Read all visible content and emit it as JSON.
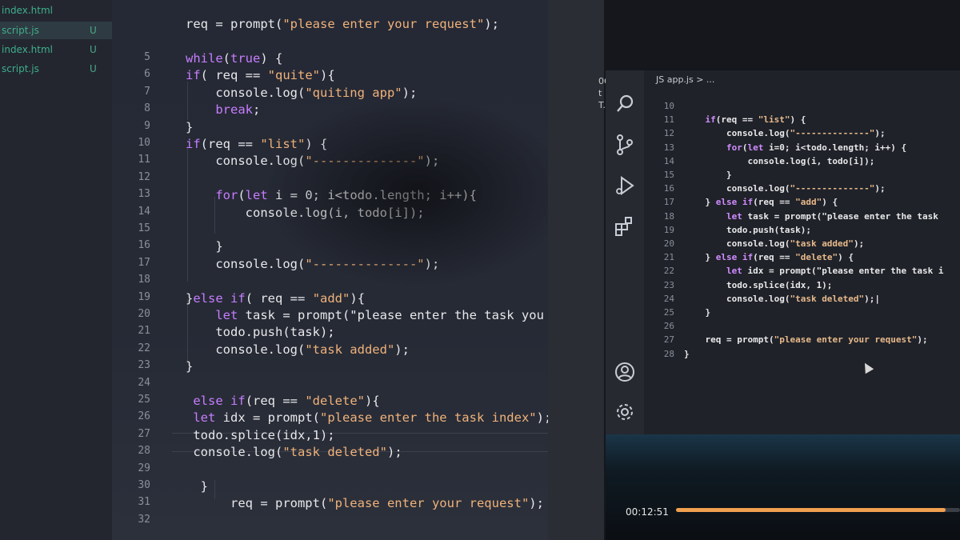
{
  "left": {
    "explorer": [
      {
        "name": "index.html",
        "status": ""
      },
      {
        "name": "script.js",
        "status": "U"
      },
      {
        "name": "index.html",
        "status": "U"
      },
      {
        "name": "script.js",
        "status": "U"
      }
    ],
    "line_numbers": [
      "5",
      "6",
      "7",
      "8",
      "9",
      "10",
      "11",
      "12",
      "13",
      "14",
      "15",
      "16",
      "17",
      "18",
      "19",
      "20",
      "21",
      "22",
      "23",
      "24",
      "25",
      "26",
      "27",
      "28",
      "29",
      "30",
      "31",
      "32"
    ],
    "top_line": "req = prompt(\"please enter your request\");",
    "code": [
      "while(true) {",
      "if( req == \"quite\"){",
      "    console.log(\"quiting app\");",
      "    break;",
      "}",
      "if(req == \"list\") {",
      "    console.log(\"--------------\");",
      "",
      "    for(let i = 0; i<todo.length; i++){",
      "        console.log(i, todo[i]);",
      "",
      "    }",
      "    console.log(\"--------------\");",
      "",
      "}else if( req == \"add\"){",
      "    let task = prompt(\"please enter the task you want",
      "    todo.push(task);",
      "    console.log(\"task added\");",
      "}",
      "",
      " else if(req == \"delete\"){",
      " let idx = prompt(\"please enter the task index\");",
      " todo.splice(idx,1);",
      " console.log(\"task deleted\");",
      "",
      "  }",
      "      req = prompt(\"please enter your request\");",
      ""
    ]
  },
  "right": {
    "side_text": [
      "06",
      "t",
      "T."
    ],
    "tab_title": "JS app.js > ...",
    "line_numbers": [
      "10",
      "11",
      "12",
      "13",
      "14",
      "15",
      "16",
      "17",
      "18",
      "19",
      "20",
      "21",
      "22",
      "23",
      "24",
      "25",
      "26",
      "27",
      "28"
    ],
    "code": [
      "",
      "    if(req == \"list\") {",
      "        console.log(\"--------------\");",
      "        for(let i=0; i<todo.length; i++) {",
      "            console.log(i, todo[i]);",
      "        }",
      "        console.log(\"--------------\");",
      "    } else if(req == \"add\") {",
      "        let task = prompt(\"please enter the task",
      "        todo.push(task);",
      "        console.log(\"task added\");",
      "    } else if(req == \"delete\") {",
      "        let idx = prompt(\"please enter the task i",
      "        todo.splice(idx, 1);",
      "        console.log(\"task deleted\");|",
      "    }",
      "",
      "    req = prompt(\"please enter your request\");",
      "}"
    ],
    "activity_icons": [
      "search-icon",
      "source-control-icon",
      "run-debug-icon",
      "extensions-icon",
      "account-icon",
      "settings-gear-icon"
    ],
    "video": {
      "time": "00:12:51",
      "progress": 0.95
    }
  }
}
